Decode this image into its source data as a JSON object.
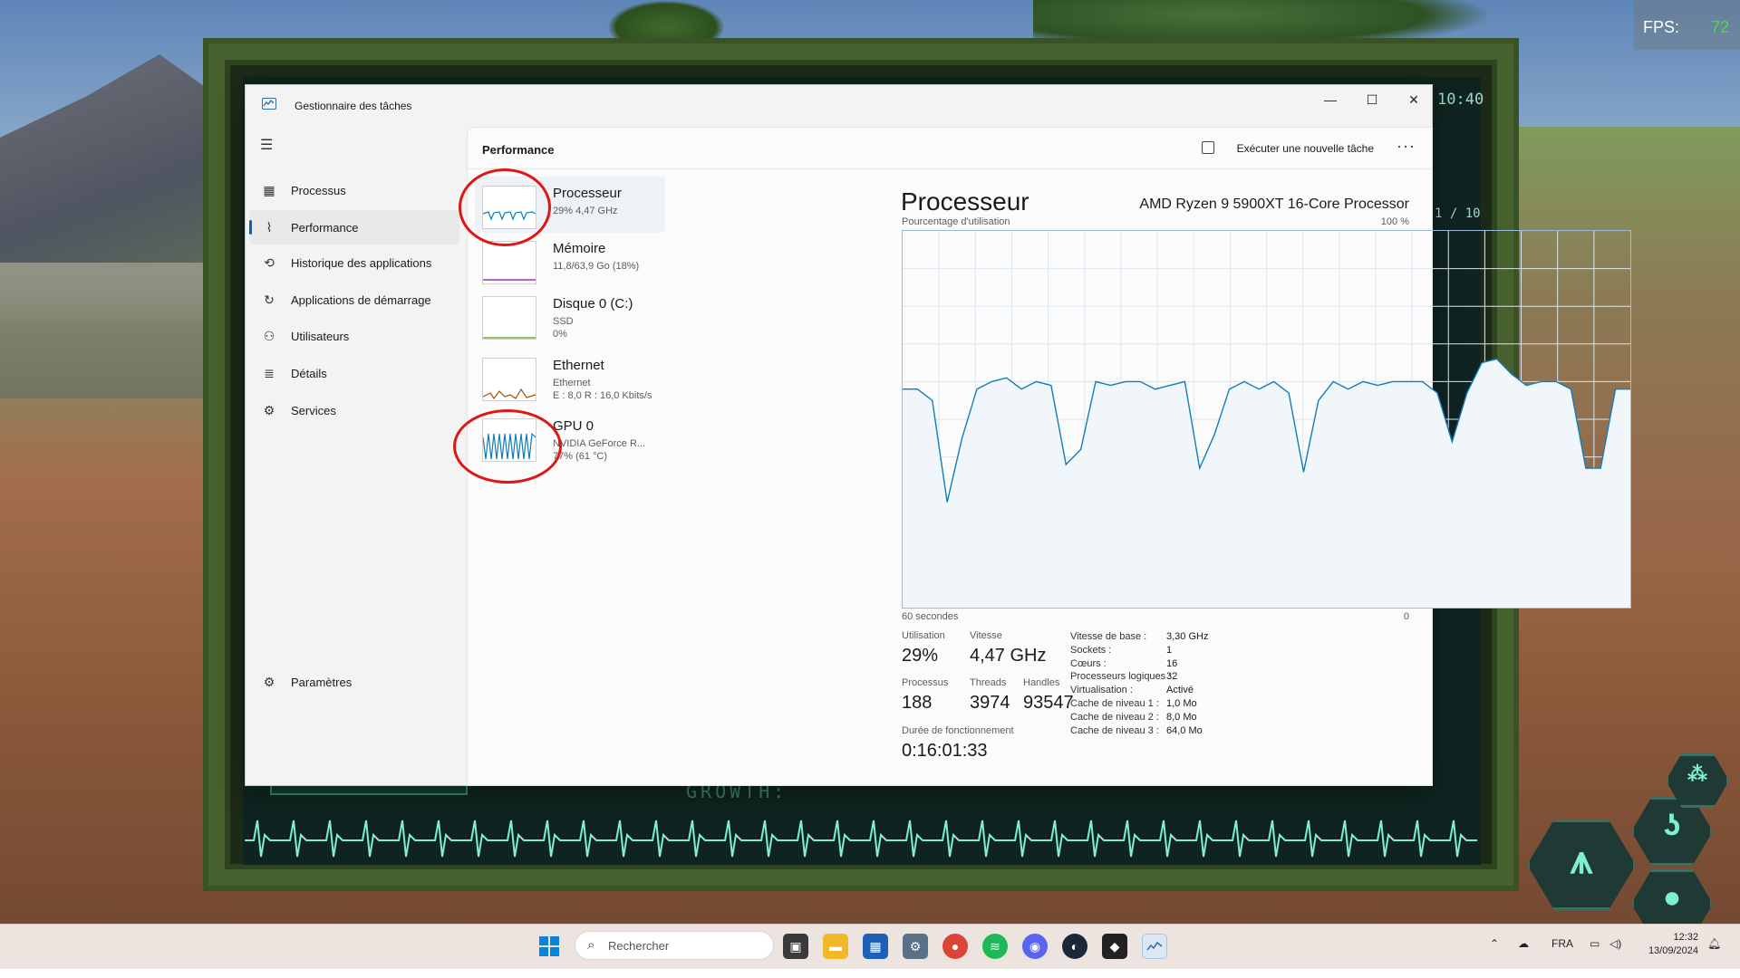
{
  "hud": {
    "fps_label": "FPS:",
    "fps_value": "72",
    "clock": "10:40",
    "counter": "1 / 10",
    "growth": "GROWTH:"
  },
  "window": {
    "title": "Gestionnaire des tâches",
    "controls": {
      "minimize": "—",
      "maximize": "☐",
      "close": "✕"
    }
  },
  "nav": {
    "items": [
      {
        "label": "Processus",
        "icon": "processes-icon"
      },
      {
        "label": "Performance",
        "icon": "performance-icon",
        "active": true
      },
      {
        "label": "Historique des applications",
        "icon": "history-icon"
      },
      {
        "label": "Applications de démarrage",
        "icon": "startup-icon"
      },
      {
        "label": "Utilisateurs",
        "icon": "users-icon"
      },
      {
        "label": "Détails",
        "icon": "details-icon"
      },
      {
        "label": "Services",
        "icon": "services-icon"
      }
    ],
    "settings": "Paramètres"
  },
  "content": {
    "title": "Performance",
    "new_task": "Exécuter une nouvelle tâche"
  },
  "devices": [
    {
      "name": "Processeur",
      "sub1": "29% 4,47 GHz",
      "sub2": "",
      "color": "#117dbb",
      "active": true
    },
    {
      "name": "Mémoire",
      "sub1": "11,8/63,9 Go (18%)",
      "sub2": "",
      "color": "#8b12ae"
    },
    {
      "name": "Disque 0 (C:)",
      "sub1": "SSD",
      "sub2": "0%",
      "color": "#4da60c"
    },
    {
      "name": "Ethernet",
      "sub1": "Ethernet",
      "sub2": "E : 8,0 R : 16,0 Kbits/s",
      "color": "#a74f01"
    },
    {
      "name": "GPU 0",
      "sub1": "NVIDIA GeForce R...",
      "sub2": "77% (61 °C)",
      "color": "#117dbb"
    }
  ],
  "cpu": {
    "title": "Processeur",
    "model": "AMD Ryzen 9 5900XT 16-Core Processor",
    "graph_label": "Pourcentage d'utilisation",
    "graph_max": "100 %",
    "graph_time": "60 secondes",
    "graph_min": "0",
    "usage_series": [
      58,
      58,
      55,
      28,
      45,
      58,
      60,
      61,
      58,
      60,
      59,
      38,
      42,
      60,
      59,
      60,
      60,
      58,
      59,
      60,
      37,
      46,
      58,
      60,
      58,
      60,
      57,
      36,
      55,
      60,
      58,
      60,
      59,
      60,
      60,
      60,
      57,
      44,
      57,
      65,
      66,
      62,
      59,
      60,
      60,
      58,
      37,
      37,
      58,
      58
    ],
    "stats": {
      "utilisation": {
        "label": "Utilisation",
        "value": "29%"
      },
      "vitesse": {
        "label": "Vitesse",
        "value": "4,47 GHz"
      },
      "processus": {
        "label": "Processus",
        "value": "188"
      },
      "threads": {
        "label": "Threads",
        "value": "3974"
      },
      "handles": {
        "label": "Handles",
        "value": "93547"
      },
      "duree": {
        "label": "Durée de fonctionnement",
        "value": "0:16:01:33"
      }
    },
    "specs": [
      {
        "k": "Vitesse de base :",
        "v": "3,30 GHz"
      },
      {
        "k": "Sockets :",
        "v": "1"
      },
      {
        "k": "Cœurs :",
        "v": "16"
      },
      {
        "k": "Processeurs logiques :",
        "v": "32"
      },
      {
        "k": "Virtualisation :",
        "v": "Activé"
      },
      {
        "k": "Cache de niveau 1 :",
        "v": "1,0 Mo"
      },
      {
        "k": "Cache de niveau 2 :",
        "v": "8,0 Mo"
      },
      {
        "k": "Cache de niveau 3 :",
        "v": "64,0 Mo"
      }
    ]
  },
  "taskbar": {
    "search": "Rechercher",
    "language": "FRA",
    "time": "12:32",
    "date": "13/09/2024"
  }
}
